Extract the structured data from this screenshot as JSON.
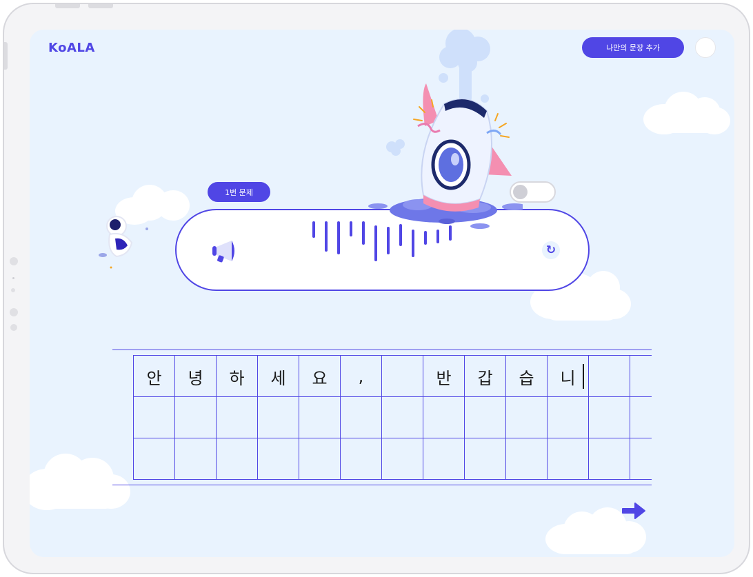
{
  "app": {
    "logo": "KoALA"
  },
  "header": {
    "add_sentence_label": "나만의 문장 추가"
  },
  "question": {
    "badge_label": "1번 문제"
  },
  "writing_grid": {
    "rows": [
      [
        "안",
        "녕",
        "하",
        "세",
        "요",
        ",",
        "",
        "반",
        "갑",
        "습",
        "니",
        "",
        ""
      ],
      [
        "",
        "",
        "",
        "",
        "",
        "",
        "",
        "",
        "",
        "",
        "",
        "",
        ""
      ],
      [
        "",
        "",
        "",
        "",
        "",
        "",
        "",
        "",
        "",
        "",
        "",
        "",
        ""
      ]
    ]
  },
  "colors": {
    "accent": "#5046e5",
    "background": "#e9f3fe"
  },
  "icons": {
    "speaker": "megaphone-icon",
    "refresh": "refresh-icon",
    "next": "arrow-right-icon"
  }
}
